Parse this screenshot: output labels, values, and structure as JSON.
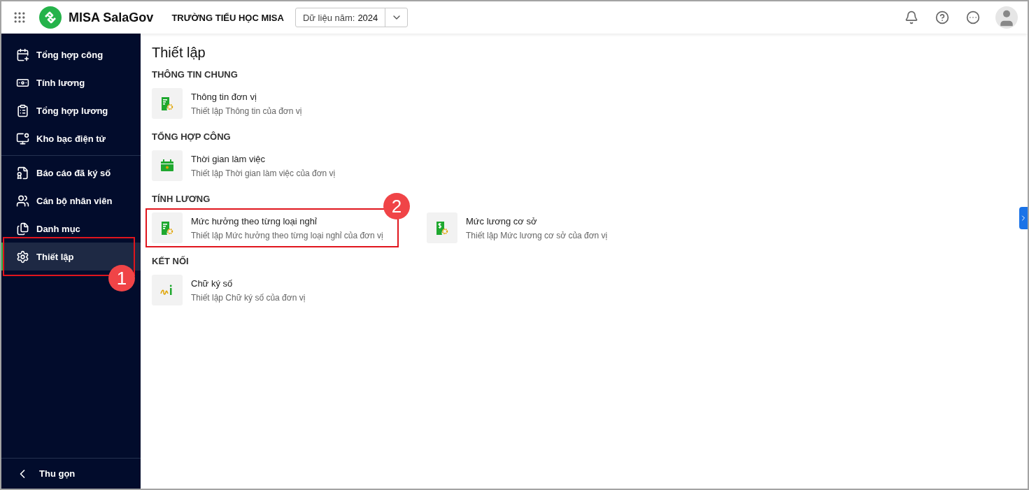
{
  "header": {
    "app_name": "MISA SalaGov",
    "org_name": "TRƯỜNG TIỂU HỌC MISA",
    "year_select": {
      "label": "Dữ liệu năm:",
      "value": "2024"
    }
  },
  "sidebar": {
    "groups": [
      {
        "items": [
          {
            "label": "Tổng hợp công",
            "selected": false
          },
          {
            "label": "Tính lương",
            "selected": false
          },
          {
            "label": "Tổng hợp lương",
            "selected": false
          },
          {
            "label": "Kho bạc điện tử",
            "selected": false
          }
        ]
      },
      {
        "items": [
          {
            "label": "Báo cáo đã ký số",
            "selected": false
          },
          {
            "label": "Cán bộ nhân viên",
            "selected": false
          },
          {
            "label": "Danh mục",
            "selected": false
          },
          {
            "label": "Thiết lập",
            "selected": true,
            "callout": "1"
          }
        ]
      }
    ],
    "collapse_label": "Thu gọn"
  },
  "page": {
    "title": "Thiết lập",
    "sections": [
      {
        "title": "THÔNG TIN CHUNG",
        "cards": [
          {
            "kind": "doc",
            "title": "Thông tin đơn vị",
            "description": "Thiết lập Thông tin của đơn vị"
          }
        ]
      },
      {
        "title": "TỔNG HỢP CÔNG",
        "cards": [
          {
            "kind": "calendar",
            "title": "Thời gian làm việc",
            "description": "Thiết lập Thời gian làm việc của đơn vị"
          }
        ]
      },
      {
        "title": "TÍNH LƯƠNG",
        "cards": [
          {
            "kind": "doc",
            "title": "Mức hưởng theo từng loại nghỉ",
            "description": "Thiết lập Mức hưởng theo từng loại nghỉ của đơn vị",
            "callout": "2"
          },
          {
            "kind": "money",
            "title": "Mức lương cơ sở",
            "description": "Thiết lập Mức lương cơ sở của đơn vị"
          }
        ]
      },
      {
        "title": "KẾT NỐI",
        "cards": [
          {
            "kind": "signature",
            "title": "Chữ ký số",
            "description": "Thiết lập Chữ ký số của đơn vị"
          }
        ]
      }
    ]
  }
}
